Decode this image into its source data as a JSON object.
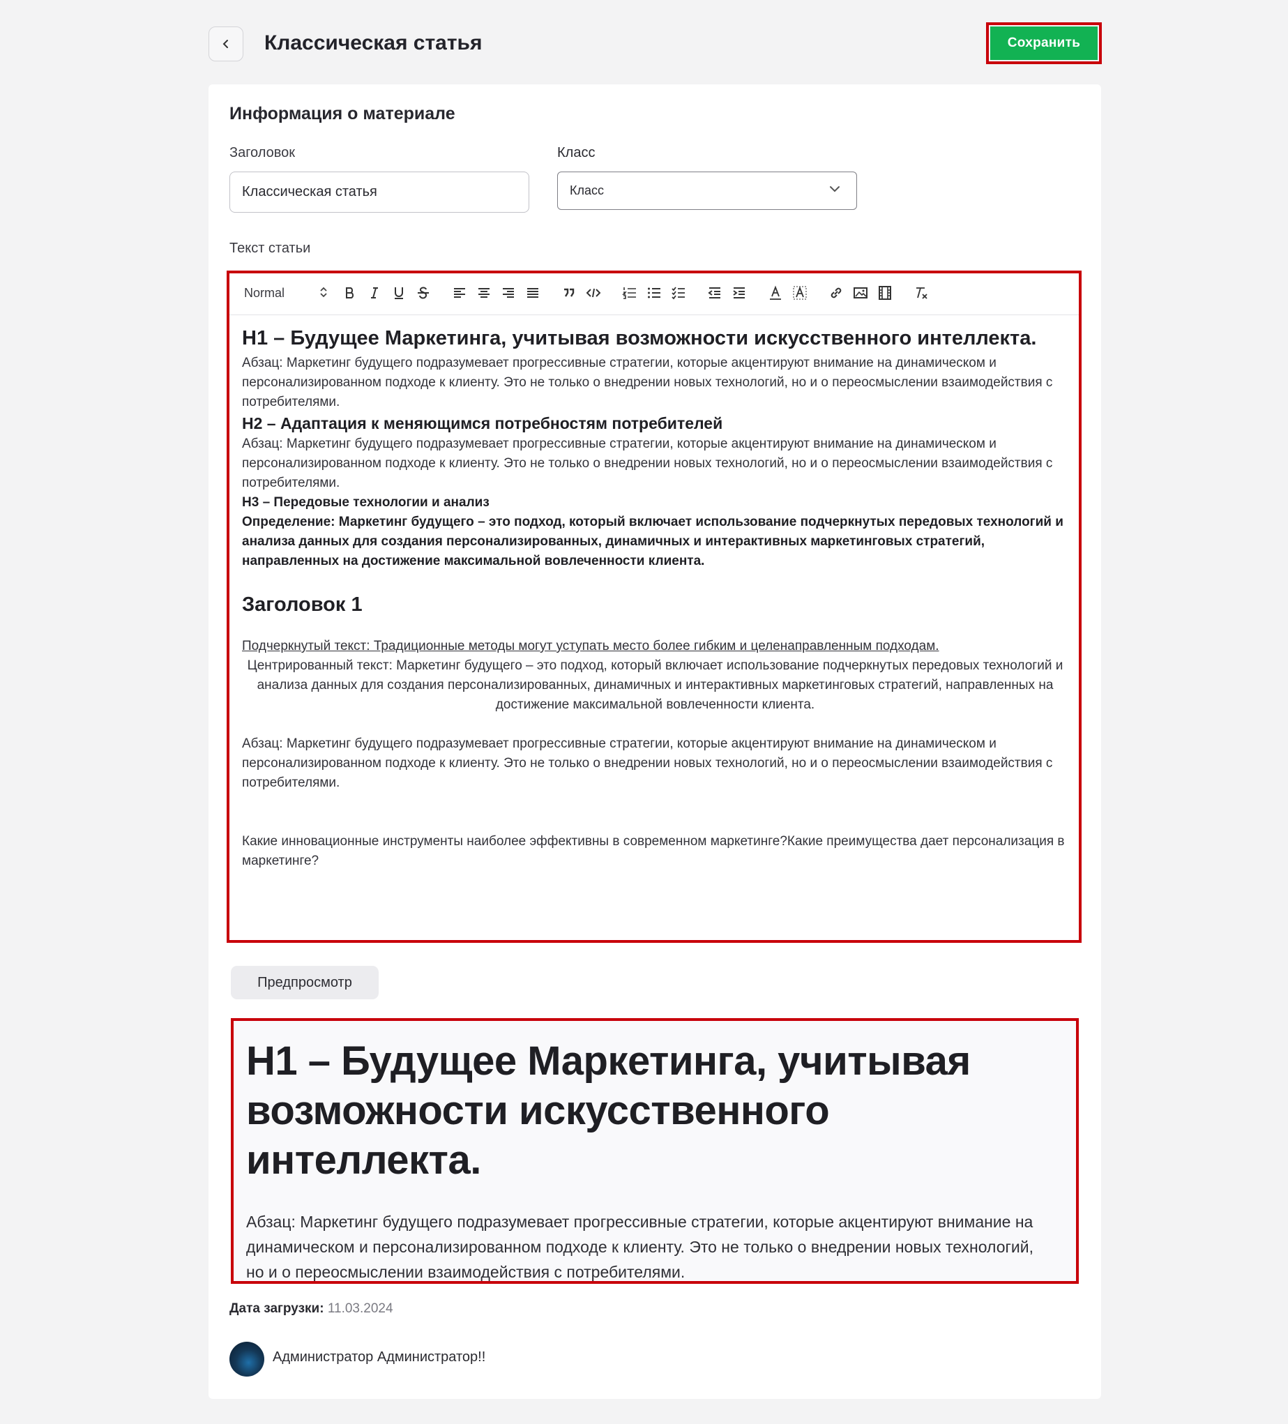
{
  "header": {
    "title": "Классическая статья",
    "save_label": "Сохранить"
  },
  "form": {
    "section_title": "Информация о материале",
    "title_label": "Заголовок",
    "title_value": "Классическая статья",
    "class_label": "Класс",
    "class_value": "Класс",
    "text_label": "Текст статьи"
  },
  "toolbar": {
    "format_value": "Normal",
    "icons": [
      "bold-icon",
      "italic-icon",
      "underline-icon",
      "strikethrough-icon",
      "align-left-icon",
      "align-center-icon",
      "align-right-icon",
      "align-justify-icon",
      "blockquote-icon",
      "code-block-icon",
      "ordered-list-icon",
      "bullet-list-icon",
      "check-list-icon",
      "outdent-icon",
      "indent-icon",
      "text-color-icon",
      "background-color-icon",
      "link-icon",
      "image-icon",
      "video-icon",
      "clear-format-icon"
    ]
  },
  "editor": {
    "h1": "H1 – Будущее Маркетинга, учитывая возможности искусственного интеллекта.",
    "p1": "Абзац: Маркетинг будущего подразумевает прогрессивные стратегии, которые акцентируют внимание на динамическом и персонализированном подходе к клиенту. Это не только о внедрении новых технологий, но и о переосмыслении взаимодействия с потребителями.",
    "h2": "H2 – Адаптация к меняющимся потребностям потребителей",
    "p2": "Абзац: Маркетинг будущего подразумевает прогрессивные стратегии, которые акцентируют внимание на динамическом и персонализированном подходе к клиенту. Это не только о внедрении новых технологий, но и о переосмыслении взаимодействия с потребителями.",
    "h3": "H3 – Передовые технологии и анализ",
    "definition": "Определение: Маркетинг будущего – это подход, который включает использование подчеркнутых передовых технологий и анализа данных для создания персонализированных, динамичных и интерактивных маркетинговых стратегий, направленных на достижение максимальной вовлеченности клиента.",
    "heading1": "Заголовок 1",
    "underlined": "Подчеркнутый текст: Традиционные методы могут уступать место более гибким и целенаправленным подходам.",
    "centered": "Центрированный текст: Маркетинг будущего – это подход, который включает использование подчеркнутых передовых технологий и анализа данных для создания персонализированных, динамичных и интерактивных маркетинговых стратегий, направленных на достижение максимальной вовлеченности клиента.",
    "p3": "Абзац: Маркетинг будущего подразумевает прогрессивные стратегии, которые акцентируют внимание на динамическом и персонализированном подходе к клиенту. Это не только о внедрении новых технологий, но и о переосмыслении взаимодействия с потребителями.",
    "question": "Какие инновационные инструменты наиболее эффективны в современном маркетинге?Какие преимущества дает персонализация в маркетинге?"
  },
  "preview": {
    "button_label": "Предпросмотр",
    "h1": "H1 – Будущее Маркетинга, учитывая возможности искусственного интеллекта.",
    "p": "Абзац: Маркетинг будущего подразумевает прогрессивные стратегии, которые акцентируют внимание на динамическом и персонализированном подходе к клиенту. Это не только о внедрении новых технологий, но и о переосмыслении взаимодействия с потребителями."
  },
  "meta": {
    "date_label": "Дата загрузки:",
    "date_value": "11.03.2024",
    "author": "Администратор Администратор!!"
  },
  "colors": {
    "accent": "#12b253",
    "highlight_border": "#c8000a"
  }
}
